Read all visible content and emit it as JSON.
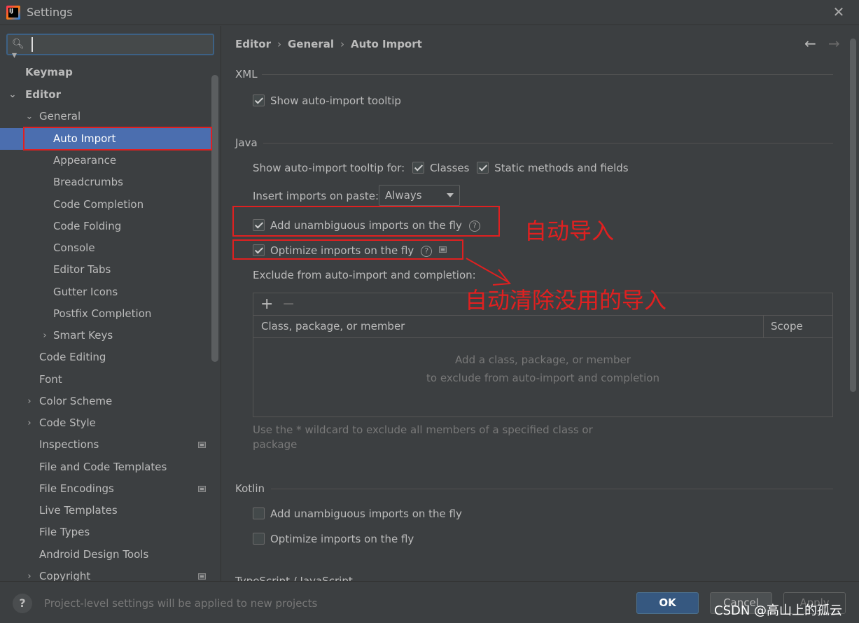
{
  "window": {
    "title": "Settings"
  },
  "search": {
    "value": ""
  },
  "sidebar": {
    "items": [
      {
        "label": "Keymap"
      },
      {
        "label": "Editor"
      },
      {
        "label": "General"
      },
      {
        "label": "Auto Import"
      },
      {
        "label": "Appearance"
      },
      {
        "label": "Breadcrumbs"
      },
      {
        "label": "Code Completion"
      },
      {
        "label": "Code Folding"
      },
      {
        "label": "Console"
      },
      {
        "label": "Editor Tabs"
      },
      {
        "label": "Gutter Icons"
      },
      {
        "label": "Postfix Completion"
      },
      {
        "label": "Smart Keys"
      },
      {
        "label": "Code Editing"
      },
      {
        "label": "Font"
      },
      {
        "label": "Color Scheme"
      },
      {
        "label": "Code Style"
      },
      {
        "label": "Inspections"
      },
      {
        "label": "File and Code Templates"
      },
      {
        "label": "File Encodings"
      },
      {
        "label": "Live Templates"
      },
      {
        "label": "File Types"
      },
      {
        "label": "Android Design Tools"
      },
      {
        "label": "Copyright"
      }
    ]
  },
  "breadcrumb": {
    "items": [
      "Editor",
      "General",
      "Auto Import"
    ]
  },
  "xml": {
    "title": "XML",
    "show_tooltip": "Show auto-import tooltip"
  },
  "java": {
    "title": "Java",
    "tooltip_for": "Show auto-import tooltip for:",
    "classes": "Classes",
    "static_methods": "Static methods and fields",
    "insert_on_paste": "Insert imports on paste:",
    "insert_on_paste_value": "Always",
    "add_unambiguous": "Add unambiguous imports on the fly",
    "optimize": "Optimize imports on the fly",
    "exclude_label": "Exclude from auto-import and completion:",
    "table": {
      "col_class": "Class, package, or member",
      "col_scope": "Scope",
      "empty_line1": "Add a class, package, or member",
      "empty_line2": "to exclude from auto-import and completion"
    },
    "wildcard_note": "Use the * wildcard to exclude all members of a specified class or package"
  },
  "kotlin": {
    "title": "Kotlin",
    "add_unambiguous": "Add unambiguous imports on the fly",
    "optimize": "Optimize imports on the fly"
  },
  "next_section": {
    "title": "TypeScript / JavaScript"
  },
  "annotations": {
    "auto_import": "自动导入",
    "auto_clean": "自动清除没用的导入",
    "color": "#e02020"
  },
  "footer": {
    "note": "Project-level settings will be applied to new projects",
    "ok": "OK",
    "cancel": "Cancel",
    "apply": "Apply",
    "watermark": "CSDN @高山上的孤云"
  },
  "colors": {
    "accent": "#4b6eaf",
    "background": "#3c3f41",
    "ok_button": "#365880"
  }
}
